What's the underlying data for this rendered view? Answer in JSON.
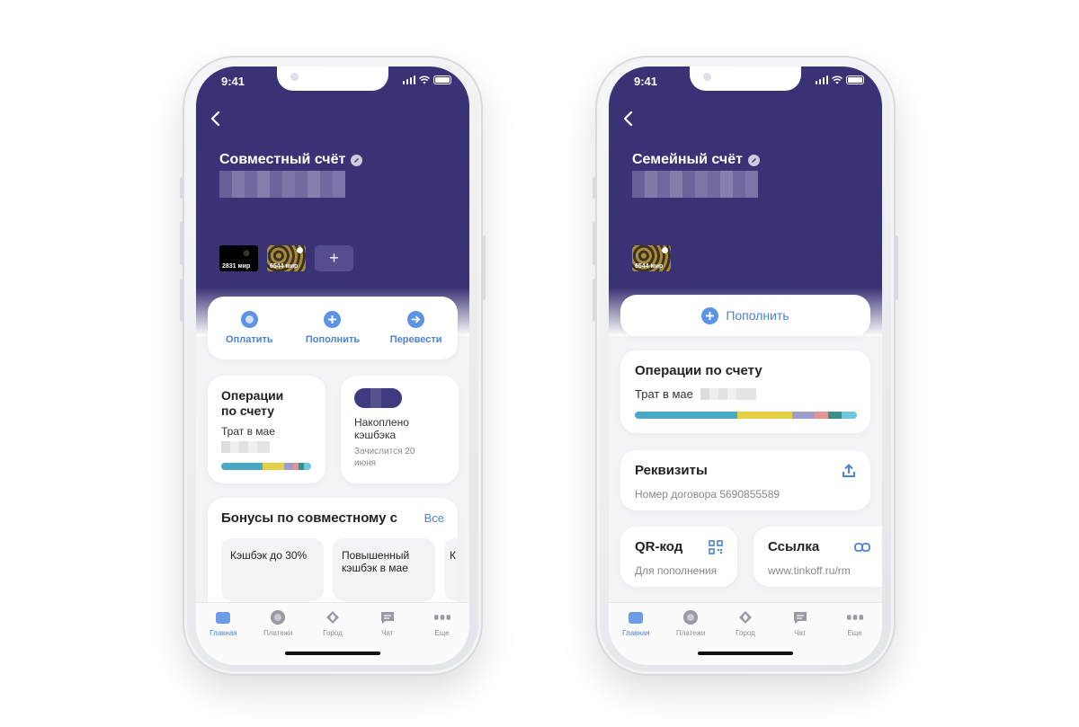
{
  "left_phone": {
    "status": {
      "time": "9:41"
    },
    "account": {
      "title": "Совместный счёт"
    },
    "cards": [
      {
        "number": "2831",
        "system": "мир"
      },
      {
        "number": "6544",
        "system": "мир"
      }
    ],
    "add_card_label": "+",
    "actions": [
      {
        "label": "Оплатить",
        "icon": "circle-icon"
      },
      {
        "label": "Пополнить",
        "icon": "plus-icon"
      },
      {
        "label": "Перевести",
        "icon": "arrow-right-icon"
      }
    ],
    "operations": {
      "title": "Операции по счету",
      "subtitle": "Трат в мае",
      "bar_colors": [
        "#4aa8c7",
        "#e4cf45",
        "#9e9ccc",
        "#e39494",
        "#3b8f86",
        "#6ec7dc"
      ]
    },
    "cashback": {
      "label": "Накоплено кэшбэка",
      "note": "Зачислится 20 июня",
      "pill_color": "#3f3a80"
    },
    "bonuses": {
      "title": "Бонусы по совместному с",
      "all_link": "Все",
      "items": [
        "Кэшбэк до 30%",
        "Повышенный кэшбэк в мае",
        "К д в"
      ]
    }
  },
  "right_phone": {
    "status": {
      "time": "9:41"
    },
    "account": {
      "title": "Семейный счёт"
    },
    "cards": [
      {
        "number": "6544",
        "system": "мир"
      }
    ],
    "topup_button": "Пополнить",
    "operations": {
      "title": "Операции по счету",
      "subtitle": "Трат в мае",
      "bar_colors": [
        "#4aa8c7",
        "#e4cf45",
        "#9e9ccc",
        "#e39494",
        "#3b8f86",
        "#6ec7dc"
      ]
    },
    "requisites": {
      "title": "Реквизиты",
      "contract": "Номер договора 5690855589",
      "icon": "share-icon"
    },
    "qr": {
      "title": "QR-код",
      "subtitle": "Для пополнения",
      "icon": "qr-icon"
    },
    "link": {
      "title": "Ссылка",
      "subtitle": "www.tinkoff.ru/rm",
      "icon": "link-icon"
    }
  },
  "tabbar": {
    "tabs": [
      {
        "label": "Главная",
        "icon": "home-icon",
        "active": true
      },
      {
        "label": "Платежи",
        "icon": "payments-icon",
        "active": false
      },
      {
        "label": "Город",
        "icon": "city-icon",
        "active": false
      },
      {
        "label": "Чат",
        "icon": "chat-icon",
        "active": false
      },
      {
        "label": "Еще",
        "icon": "more-icon",
        "active": false
      }
    ]
  },
  "colors": {
    "header": "#393375",
    "accent": "#4c82d6",
    "background": "#f4f4f7"
  }
}
